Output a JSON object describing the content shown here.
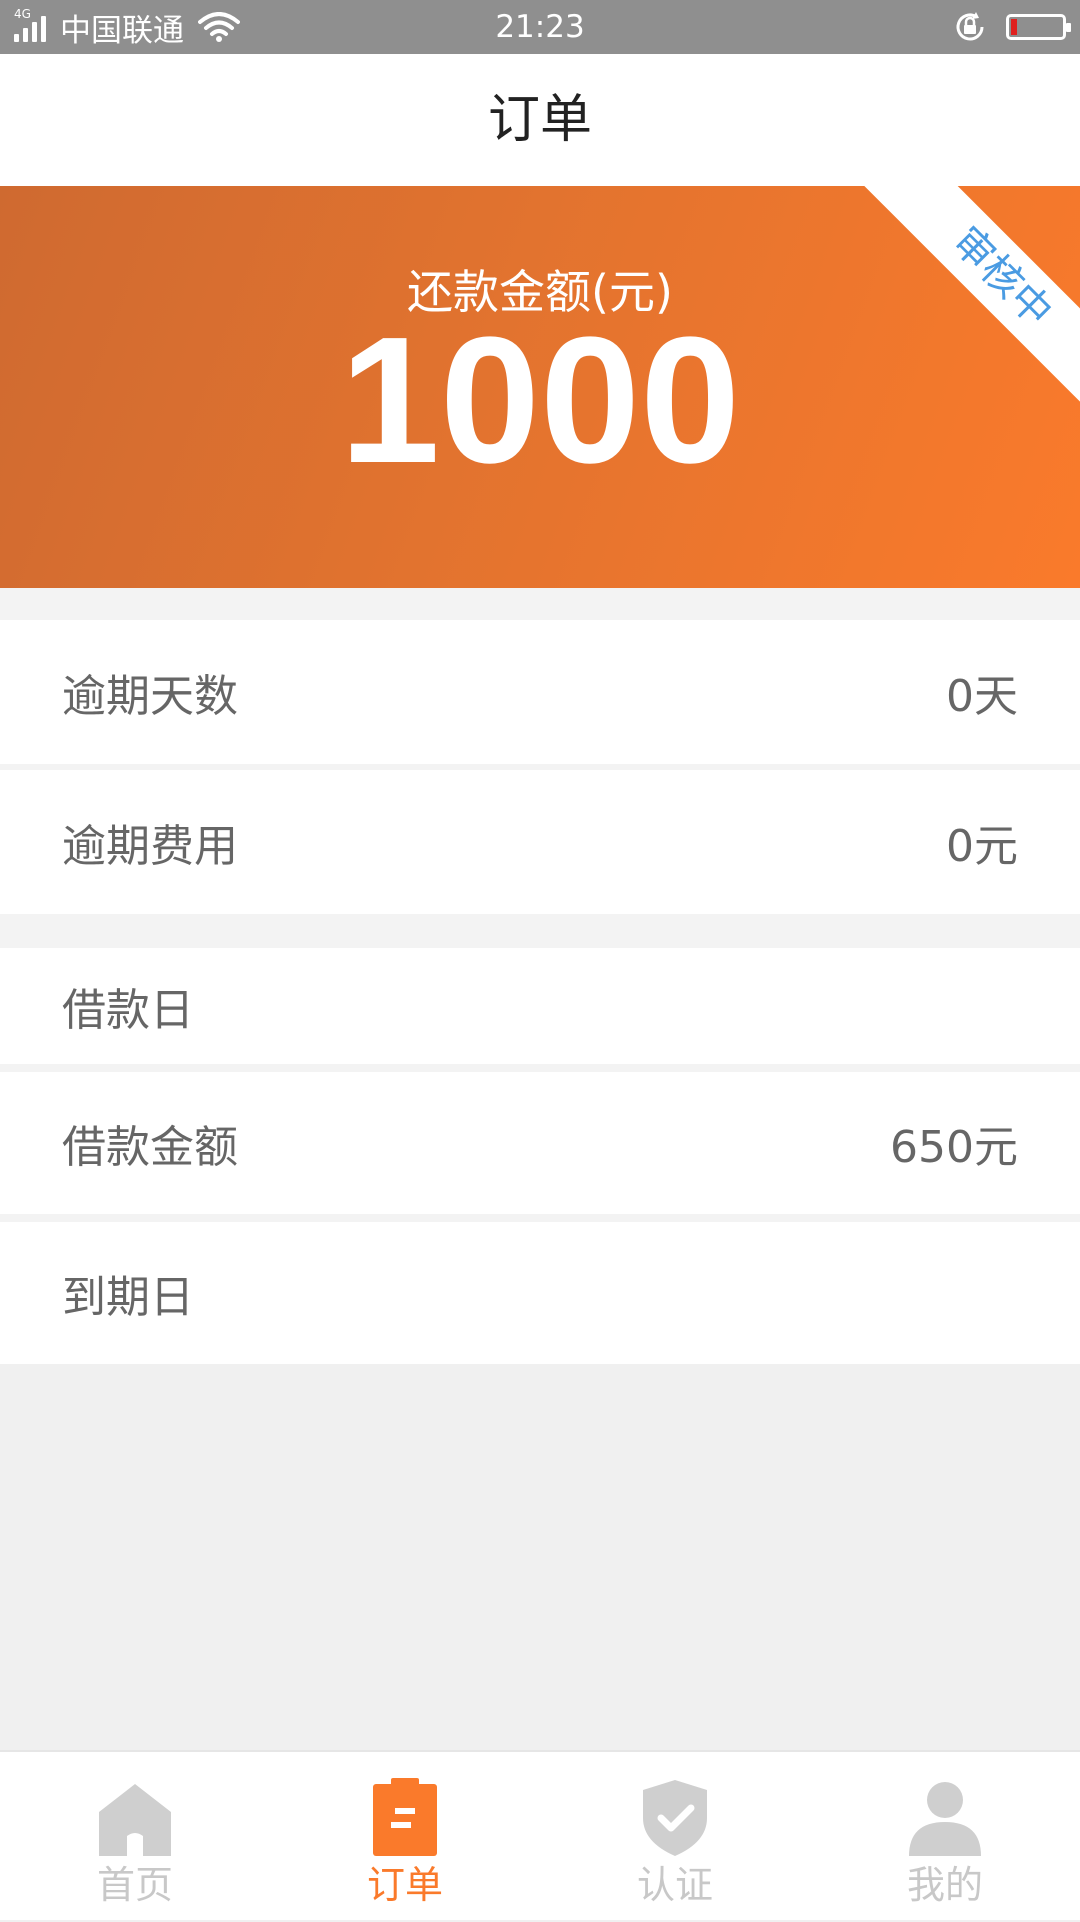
{
  "status_bar": {
    "network": "4G",
    "carrier": "中国联通",
    "time": "21:23"
  },
  "header": {
    "title": "订单"
  },
  "hero": {
    "label": "还款金额(元)",
    "amount": "1000",
    "ribbon": "审核中",
    "colors": {
      "gradient_start": "#cf6a30",
      "gradient_end": "#fa7a2b",
      "ribbon_text": "#4a9be2"
    }
  },
  "details": [
    {
      "label": "逾期天数",
      "value": "0天"
    },
    {
      "label": "逾期费用",
      "value": "0元"
    },
    {
      "label": "借款日",
      "value": ""
    },
    {
      "label": "借款金额",
      "value": "650元"
    },
    {
      "label": "到期日",
      "value": ""
    }
  ],
  "bottom_nav": {
    "items": [
      {
        "label": "首页",
        "icon": "home-icon",
        "active": false
      },
      {
        "label": "订单",
        "icon": "order-icon",
        "active": true
      },
      {
        "label": "认证",
        "icon": "shield-check-icon",
        "active": false
      },
      {
        "label": "我的",
        "icon": "user-icon",
        "active": false
      }
    ],
    "colors": {
      "active": "#fa7a2b",
      "inactive": "#c8c8c8"
    }
  }
}
